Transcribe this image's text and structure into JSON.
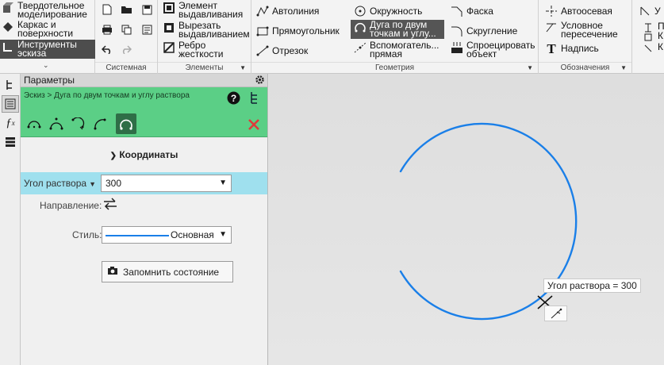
{
  "ribbon": {
    "left_group": {
      "items": [
        {
          "line1": "Твердотельное",
          "line2": "моделирование"
        },
        {
          "line1": "Каркас и",
          "line2": "поверхности"
        },
        {
          "line1": "Инструменты",
          "line2": "эскиза"
        }
      ]
    },
    "system_group": {
      "label": "Системная"
    },
    "elements_group": {
      "label": "Элементы",
      "items": [
        {
          "line1": "Элемент",
          "line2": "выдавливания"
        },
        {
          "line1": "Вырезать",
          "line2": "выдавливанием"
        },
        {
          "line1": "Ребро",
          "line2": "жесткости"
        }
      ]
    },
    "geometry_group": {
      "label": "Геометрия",
      "col1": [
        "Автолиния",
        "Прямоугольник",
        "Отрезок"
      ],
      "col2": [
        {
          "line1": "Окружность",
          "line2": ""
        },
        {
          "line1": "Дуга по двум",
          "line2": "точкам и углу..."
        },
        {
          "line1": "Вспомогатель...",
          "line2": "прямая"
        }
      ],
      "col3": [
        {
          "line1": "Фаска",
          "line2": ""
        },
        {
          "line1": "Скругление",
          "line2": ""
        },
        {
          "line1": "Спроецировать",
          "line2": "объект"
        }
      ]
    },
    "notation_group": {
      "label": "Обозначения",
      "items": [
        {
          "line1": "Автоосевая",
          "line2": ""
        },
        {
          "line1": "Условное",
          "line2": "пересечение"
        },
        {
          "line1": "Надпись",
          "line2": ""
        }
      ]
    },
    "cut_group": {
      "items": [
        "У",
        "П",
        "К",
        "К"
      ]
    }
  },
  "panel": {
    "title": "Параметры",
    "breadcrumb": "Эскиз > Дуга по двум точкам и углу раствора",
    "section": "Координаты",
    "angle_label": "Угол раствора",
    "angle_value": "300",
    "direction_label": "Направление:",
    "style_label": "Стиль:",
    "style_value": "Основная",
    "save_button": "Запомнить состояние"
  },
  "canvas": {
    "tooltip": "Угол раствора = 300",
    "arc_color": "#1a7fe8"
  },
  "colors": {
    "panel_accent": "#5bcf86",
    "highlight_row": "#9fe0ee",
    "close_icon": "#e03a3a"
  }
}
